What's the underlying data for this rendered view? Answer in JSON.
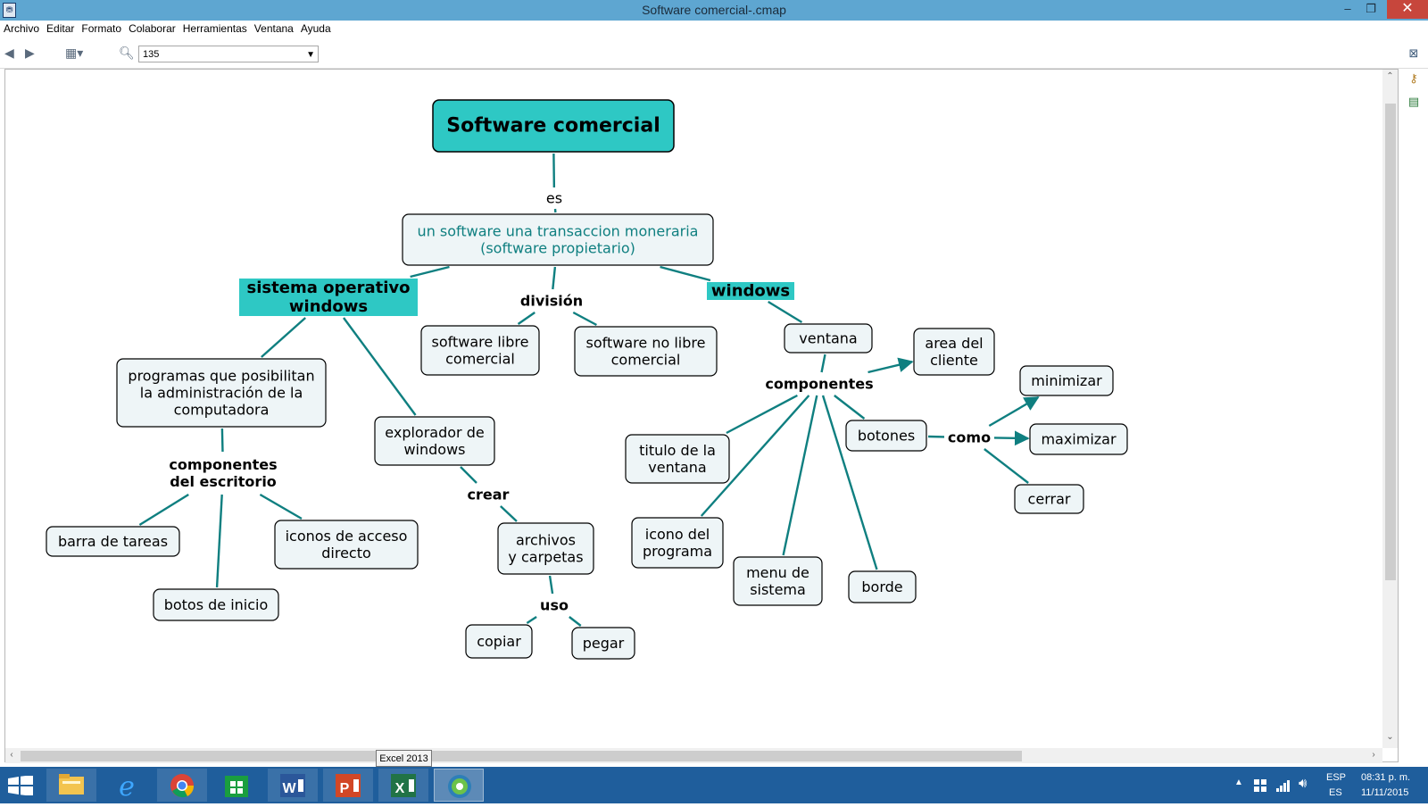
{
  "window": {
    "title": "Software comercial-.cmap",
    "min_symbol": "–",
    "restore_symbol": "❐",
    "close_symbol": "✕"
  },
  "menu": [
    "Archivo",
    "Editar",
    "Formato",
    "Colaborar",
    "Herramientas",
    "Ventana",
    "Ayuda"
  ],
  "toolbar": {
    "zoom_value": "135"
  },
  "concept_map": {
    "nodes": [
      {
        "id": "root",
        "lines": [
          "Software comercial"
        ],
        "style": "title"
      },
      {
        "id": "def",
        "lines": [
          "un software una transaccion moneraria",
          "(software propietario)"
        ],
        "style": "box-teal"
      },
      {
        "id": "sow",
        "lines": [
          "sistema operativo",
          "windows"
        ],
        "style": "highlight"
      },
      {
        "id": "win",
        "lines": [
          "windows"
        ],
        "style": "highlight"
      },
      {
        "id": "prog",
        "lines": [
          "programas que posibilitan",
          "la administración de la",
          "computadora"
        ],
        "style": "box"
      },
      {
        "id": "expl",
        "lines": [
          "explorador de",
          "windows"
        ],
        "style": "box"
      },
      {
        "id": "slc",
        "lines": [
          "software libre",
          "comercial"
        ],
        "style": "box"
      },
      {
        "id": "snlc",
        "lines": [
          "software no libre",
          "comercial"
        ],
        "style": "box"
      },
      {
        "id": "ventana",
        "lines": [
          "ventana"
        ],
        "style": "box"
      },
      {
        "id": "area",
        "lines": [
          "area del",
          "cliente"
        ],
        "style": "box"
      },
      {
        "id": "barra",
        "lines": [
          "barra de tareas"
        ],
        "style": "box"
      },
      {
        "id": "iconos",
        "lines": [
          "iconos de acceso",
          "directo"
        ],
        "style": "box"
      },
      {
        "id": "botos",
        "lines": [
          "botos de inicio"
        ],
        "style": "box"
      },
      {
        "id": "archivos",
        "lines": [
          "archivos",
          "y carpetas"
        ],
        "style": "box"
      },
      {
        "id": "copiar",
        "lines": [
          "copiar"
        ],
        "style": "box"
      },
      {
        "id": "pegar",
        "lines": [
          "pegar"
        ],
        "style": "box"
      },
      {
        "id": "titulo",
        "lines": [
          "titulo de la",
          "ventana"
        ],
        "style": "box"
      },
      {
        "id": "iconoprog",
        "lines": [
          "icono del",
          "programa"
        ],
        "style": "box"
      },
      {
        "id": "menu",
        "lines": [
          "menu de",
          "sistema"
        ],
        "style": "box"
      },
      {
        "id": "borde",
        "lines": [
          "borde"
        ],
        "style": "box"
      },
      {
        "id": "botones",
        "lines": [
          "botones"
        ],
        "style": "box"
      },
      {
        "id": "minimizar",
        "lines": [
          "minimizar"
        ],
        "style": "box"
      },
      {
        "id": "maximizar",
        "lines": [
          "maximizar"
        ],
        "style": "box"
      },
      {
        "id": "cerrar",
        "lines": [
          "cerrar"
        ],
        "style": "box"
      }
    ],
    "link_labels": [
      {
        "id": "es",
        "lines": [
          "es"
        ],
        "bold": false
      },
      {
        "id": "division",
        "lines": [
          "división"
        ],
        "bold": true
      },
      {
        "id": "compesc",
        "lines": [
          "componentes",
          "del escritorio"
        ],
        "bold": true
      },
      {
        "id": "crear",
        "lines": [
          "crear"
        ],
        "bold": true
      },
      {
        "id": "uso",
        "lines": [
          "uso"
        ],
        "bold": true
      },
      {
        "id": "componentes",
        "lines": [
          "componentes"
        ],
        "bold": true
      },
      {
        "id": "como",
        "lines": [
          "como"
        ],
        "bold": true
      }
    ]
  },
  "tooltip": "Excel 2013",
  "tray": {
    "lang_top": "ESP",
    "lang_bottom": "ES",
    "time": "08:31 p. m.",
    "date": "11/11/2015"
  },
  "colors": {
    "teal": "#2ec8c4",
    "link": "#0f7f80",
    "node_fill": "#eef5f7",
    "titlebar": "#5ea6d1",
    "taskbar": "#1f5e9c"
  }
}
